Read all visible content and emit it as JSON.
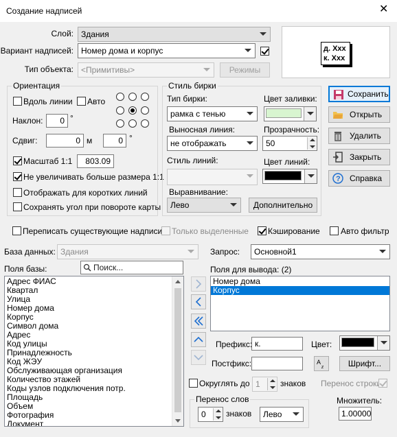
{
  "window": {
    "title": "Создание надписей",
    "close_glyph": "✕"
  },
  "layer": {
    "label": "Слой:",
    "value": "Здания"
  },
  "variant": {
    "label": "Вариант надписей:",
    "value": "Номер дома и корпус",
    "checked": true
  },
  "object_type": {
    "label": "Тип объекта:",
    "value": "<Примитивы>",
    "modes_button": "Режимы"
  },
  "preview": {
    "line1": "д. Xxx",
    "line2": "к. Xxx"
  },
  "orientation": {
    "title": "Ориентация",
    "along_line": "Вдоль линии",
    "auto": "Авто",
    "tilt_label": "Наклон:",
    "tilt_value": "0",
    "tilt_unit": "°",
    "shift_label": "Сдвиг:",
    "shift_value": "0",
    "shift_unit": "м",
    "shift_value2": "0",
    "shift_unit2": "°",
    "scale_label": "Масштаб 1:1",
    "scale_value": "803.09",
    "no_enlarge": "Не увеличивать больше размера 1:1",
    "show_short": "Отображать для коротких линий",
    "keep_angle": "Сохранять угол при повороте карты"
  },
  "tag_style": {
    "title": "Стиль бирки",
    "type_label": "Тип бирки:",
    "type_value": "рамка с тенью",
    "fill_label": "Цвет заливки:",
    "fill_color": "#d8f5d0",
    "leader_label": "Выносная линия:",
    "leader_value": "не отображать",
    "transparency_label": "Прозрачность:",
    "transparency_value": "50",
    "line_style_label": "Стиль линий:",
    "line_color_label": "Цвет линий:",
    "line_color": "#000000",
    "align_label": "Выравнивание:",
    "align_value": "Лево",
    "more_button": "Дополнительно"
  },
  "side_buttons": {
    "save": "Сохранить",
    "open": "Открыть",
    "delete": "Удалить",
    "close": "Закрыть",
    "help": "Справка"
  },
  "options_row": {
    "overwrite": "Переписать существующие надписи",
    "only_selected": "Только выделенные",
    "caching": "Кэширование",
    "auto_filter": "Авто фильтр"
  },
  "database": {
    "label": "База данных:",
    "value": "Здания"
  },
  "query": {
    "label": "Запрос:",
    "value": "Основной1"
  },
  "fields": {
    "label": "Поля базы:",
    "search_placeholder": "Поиск...",
    "items": [
      "Адрес ФИАС",
      "Квартал",
      "Улица",
      "Номер дома",
      "Корпус",
      "Символ дома",
      "Адрес",
      "Код улицы",
      "Принадлежность",
      "Код ЖЭУ",
      "Обслуживающая организация",
      "Количество этажей",
      "Коды узлов подключения потр.",
      "Площадь",
      "Объем",
      "Фотография",
      "Документ"
    ]
  },
  "output": {
    "label": "Поля для вывода: (2)",
    "items": [
      "Номер дома",
      "Корпус"
    ],
    "selected_index": 1
  },
  "format": {
    "prefix_label": "Префикс:",
    "prefix_value": "к.",
    "color_label": "Цвет:",
    "color": "#000000",
    "postfix_label": "Постфикс:",
    "postfix_value": "",
    "font_button": "Шрифт...",
    "round_label": "Округлять до",
    "round_value": "1",
    "round_unit": "знаков",
    "wrap_line": "Перенос строки"
  },
  "wrap_words": {
    "title": "Перенос слов",
    "value": "0",
    "unit": "знаков",
    "align_value": "Лево"
  },
  "multiplier": {
    "label": "Множитель:",
    "value": "1.00000"
  }
}
